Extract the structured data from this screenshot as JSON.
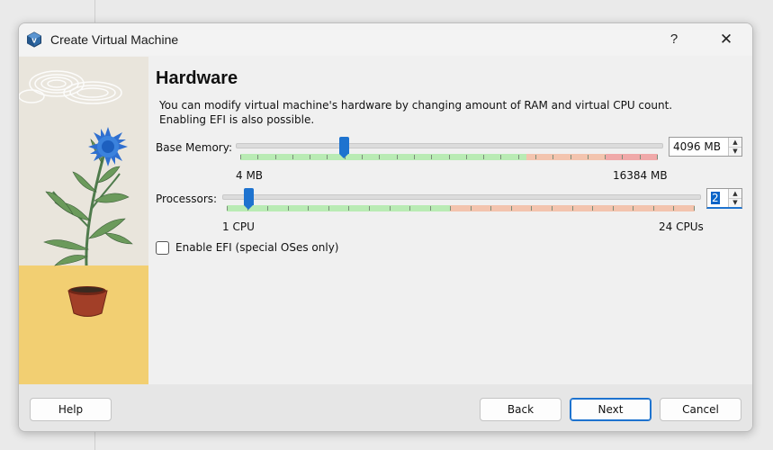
{
  "window": {
    "title": "Create Virtual Machine",
    "help_button": "?",
    "close_button": "✕"
  },
  "page": {
    "heading": "Hardware",
    "description_line1": "You can modify virtual machine's hardware by changing amount of RAM and virtual CPU count.",
    "description_line2": "Enabling EFI is also possible."
  },
  "memory": {
    "label": "Base Memory:",
    "value": "4096 MB",
    "value_mb": 4096,
    "min_label": "4 MB",
    "max_label": "16384 MB"
  },
  "processors": {
    "label": "Processors:",
    "value": "2",
    "value_count": 2,
    "min_label": "1 CPU",
    "max_label": "24 CPUs"
  },
  "efi": {
    "label": "Enable EFI (special OSes only)",
    "checked": false
  },
  "buttons": {
    "help": "Help",
    "back": "Back",
    "next": "Next",
    "cancel": "Cancel"
  },
  "colors": {
    "accent": "#1e73cf",
    "scale_green": "#b9ebb4",
    "scale_orange": "#f3c4ae",
    "scale_red": "#f0a9a9"
  }
}
